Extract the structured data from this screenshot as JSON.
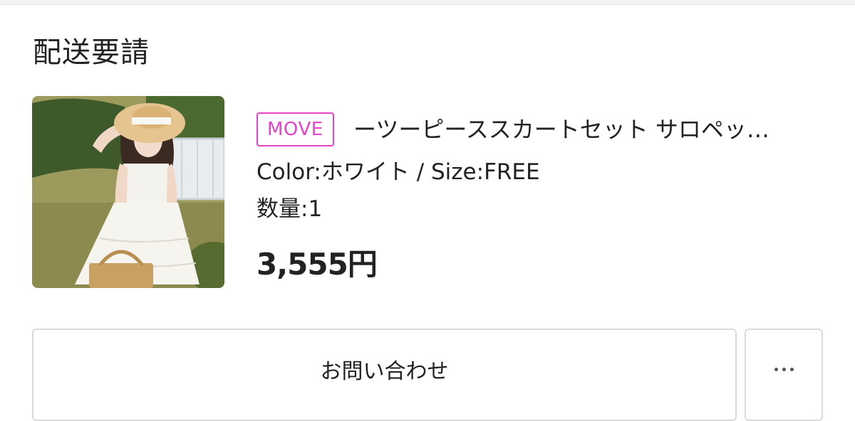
{
  "section": {
    "title": "配送要請"
  },
  "item": {
    "shop_badge": "MOVE",
    "name": "ーツーピーススカートセット サロペッ…",
    "variant": "Color:ホワイト / Size:FREE",
    "quantity": "数量:1",
    "price": "3,555円"
  },
  "actions": {
    "inquiry_label": "お問い合わせ",
    "more_label": "⋯"
  },
  "colors": {
    "badge_accent": "#e344c8",
    "button_border": "#d9d9de"
  }
}
